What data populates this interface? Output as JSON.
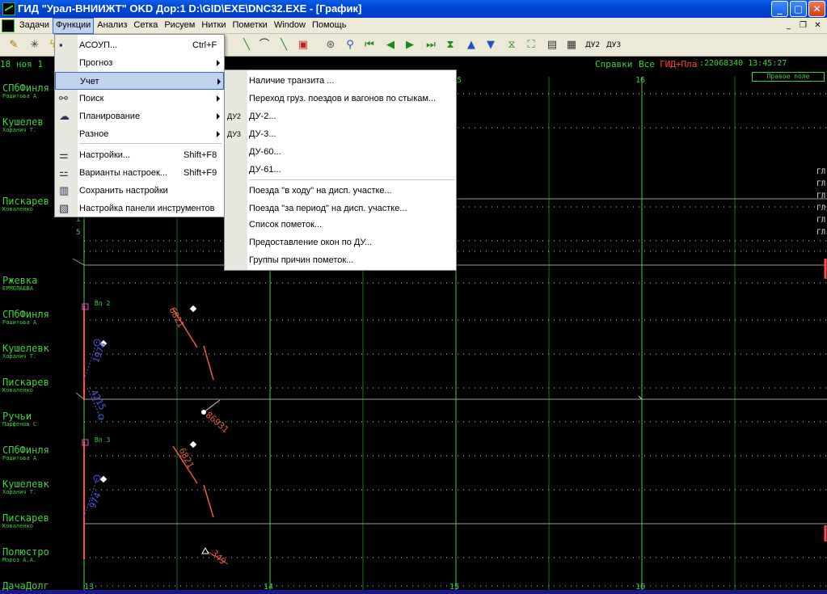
{
  "window": {
    "title": "ГИД \"Урал-ВНИИЖТ\" OKD Дор:1 D:\\GID\\EXE\\DNC32.EXE - [График]",
    "min_glyph": "_",
    "max_glyph": "▢",
    "close_glyph": "✕"
  },
  "menubar": {
    "items": [
      "Задачи",
      "Функции",
      "Анализ",
      "Сетка",
      "Рисуем",
      "Нитки",
      "Пометки",
      "Window",
      "Помощь"
    ],
    "active_index": 1,
    "mdi_min": "_",
    "mdi_restore": "❐",
    "mdi_close": "✕"
  },
  "toolbar": {
    "du2": "ДУ2",
    "du3": "ДУ3"
  },
  "header": {
    "date_time": "18 ноя 1",
    "right_links": "Справки",
    "right_all": "Все",
    "right_red": "ГИД+Пла",
    "right_num": ":22068340 13:45:27",
    "pravoe_pole": "Правое поле",
    "hour_left": "5",
    "hour_right": "16"
  },
  "stations_block1": [
    {
      "name": "СПбФинля",
      "disp": "Рашитова А"
    },
    {
      "name": "Кушелев",
      "disp": "Хоранич Т."
    },
    {
      "name": "Пискарев",
      "disp": "Коваленко"
    },
    {
      "name": "Ржевка",
      "disp": "ЕРМОЛАЕВА"
    }
  ],
  "stations_block2": [
    {
      "name": "СПбФинля",
      "disp": "Рашитова А"
    },
    {
      "name": "Кушелевк",
      "disp": "Хоранич Т."
    },
    {
      "name": "Пискарев",
      "disp": "Коваленко"
    },
    {
      "name": "Ручьи",
      "disp": "Парфенов С"
    }
  ],
  "stations_block3": [
    {
      "name": "СПбФинля",
      "disp": "Рашитова А"
    },
    {
      "name": "Кушелевк",
      "disp": "Хоранич Т."
    },
    {
      "name": "Пискарев",
      "disp": "Коваленко"
    },
    {
      "name": "Полюстро",
      "disp": "Мороз А.А."
    },
    {
      "name": "ДачаДолг",
      "disp": ""
    }
  ],
  "block_labels": {
    "b2": "Вп 2",
    "b3": "Вп 3"
  },
  "right_tags": [
    "ГЛ",
    "ГЛ",
    "ГЛ",
    "ГЛ",
    "ГЛ",
    "ГЛ"
  ],
  "small_digits": [
    "1",
    "5"
  ],
  "trains": {
    "t1": "6821",
    "t2": "1974",
    "t3": "4215",
    "t4": "86931",
    "t5": "6821",
    "t6": "974",
    "t7": "349"
  },
  "bottom_hours": [
    "13",
    "14",
    "15",
    "16"
  ],
  "functions_menu": {
    "items": [
      {
        "label": "АСОУП...",
        "shortcut": "Ctrl+F",
        "icon": "terminal-icon",
        "submenu": false
      },
      {
        "label": "Прогноз",
        "shortcut": "",
        "icon": "",
        "submenu": true
      },
      {
        "label": "Учет",
        "shortcut": "",
        "icon": "",
        "submenu": true
      },
      {
        "label": "Поиск",
        "shortcut": "",
        "icon": "binoculars-icon",
        "submenu": true
      },
      {
        "label": "Планирование",
        "shortcut": "",
        "icon": "speech-icon",
        "submenu": true
      },
      {
        "label": "Разное",
        "shortcut": "",
        "icon": "",
        "submenu": true
      },
      {
        "label": "Настройки...",
        "shortcut": "Shift+F8",
        "icon": "settings-sliders-icon",
        "submenu": false
      },
      {
        "label": "Варианты настроек...",
        "shortcut": "Shift+F9",
        "icon": "settings-variants-icon",
        "submenu": false
      },
      {
        "label": "Сохранить настройки",
        "shortcut": "",
        "icon": "save-settings-icon",
        "submenu": false
      },
      {
        "label": "Настройка панели инструментов",
        "shortcut": "",
        "icon": "toolbar-settings-icon",
        "submenu": false
      }
    ]
  },
  "uchet_menu": {
    "items": [
      {
        "label": "Наличие транзита ...",
        "tag": ""
      },
      {
        "label": "Переход груз. поездов и вагонов по стыкам...",
        "tag": ""
      },
      {
        "label": "ДУ-2...",
        "tag": "ДУ2"
      },
      {
        "label": "ДУ-3...",
        "tag": "ДУ3"
      },
      {
        "label": "ДУ-60...",
        "tag": ""
      },
      {
        "label": "ДУ-61...",
        "tag": ""
      },
      {
        "label": "Поезда \"в ходу\" на дисп. участке...",
        "tag": ""
      },
      {
        "label": "Поезда \"за период\" на дисп. участке...",
        "tag": ""
      },
      {
        "label": "Список пометок...",
        "tag": ""
      },
      {
        "label": "Предоставление окон по ДУ...",
        "tag": ""
      },
      {
        "label": "Группы причин пометок...",
        "tag": ""
      }
    ]
  },
  "colors": {
    "green": "#3fd03f",
    "red": "#ff5050",
    "train_red": "#e85a4a",
    "train_blue": "#4a5ae8",
    "highlight": "#c1d2ee"
  }
}
